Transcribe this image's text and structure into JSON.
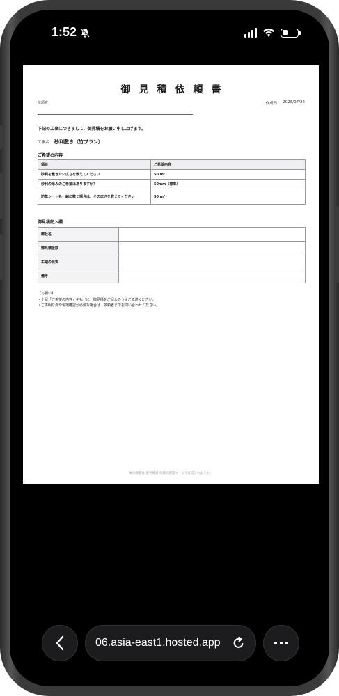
{
  "status_bar": {
    "time": "1:52",
    "icons": [
      "bell-slash-icon",
      "signal-icon",
      "wifi-icon",
      "battery-icon"
    ]
  },
  "document": {
    "title": "御見積依頼書",
    "requester_label": "依頼者",
    "date_label": "作成日",
    "date_value": "2026/07/26",
    "intro": "下記の工事につきまして、御見積をお願い申し上げます。",
    "project_label": "工事名：",
    "project_name": "砂利敷き（竹プラン）",
    "section1_title": "ご希望の内容",
    "table1": {
      "headers": [
        "項目",
        "ご希望内容"
      ],
      "rows": [
        [
          "砂利を敷きたい広さを教えてください",
          "50 m²"
        ],
        [
          "砂利の厚みのご希望はありますか？",
          "50mm（標準）"
        ],
        [
          "防草シートも一緒に敷く場合は、その広さを教えてください",
          "50 m²"
        ]
      ]
    },
    "section2_title": "御見積記入欄",
    "table2_labels": [
      "御社名",
      "御見積金額",
      "工期の目安",
      "備考"
    ],
    "notes_title": "【お願い】",
    "notes": [
      "・上記「ご希望の内容」をもとに、御見積をご記入のうえご返送ください。",
      "・ご不明な点や現地確認が必要な場合は、依頼者までお問い合わせください。"
    ],
    "footer": "本依頼書は 愛見積書 の無料配置ツールで作成されました。"
  },
  "browser": {
    "url": "06.asia-east1.hosted.app",
    "back_icon": "chevron-left-icon",
    "reload_icon": "reload-icon",
    "more_icon": "more-dots-icon"
  }
}
